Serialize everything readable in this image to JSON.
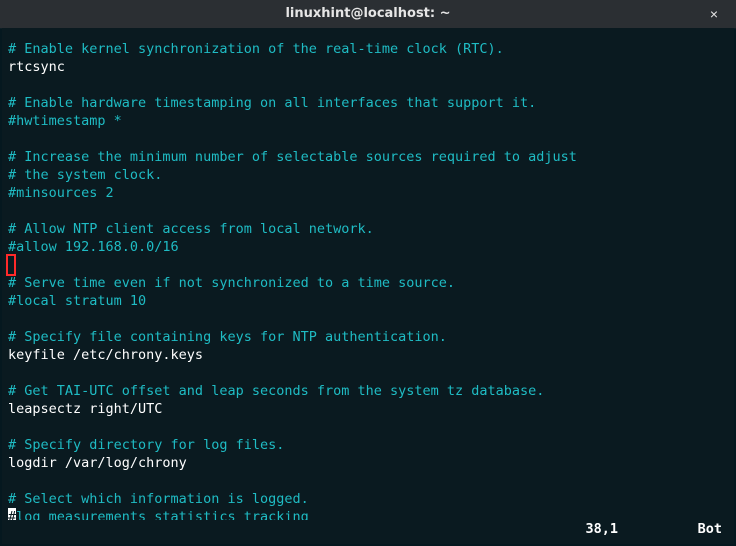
{
  "window": {
    "title": "linuxhint@localhost: ~",
    "close_label": "×"
  },
  "editor": {
    "highlight_line_index": 12,
    "cursor": {
      "line_index": 28,
      "col": 0,
      "char": "#"
    },
    "lines": [
      {
        "type": "cmt",
        "text": "# Enable kernel synchronization of the real-time clock (RTC)."
      },
      {
        "type": "txt",
        "text": "rtcsync"
      },
      {
        "type": "blk",
        "text": ""
      },
      {
        "type": "cmt",
        "text": "# Enable hardware timestamping on all interfaces that support it."
      },
      {
        "type": "cmt",
        "text": "#hwtimestamp *"
      },
      {
        "type": "blk",
        "text": ""
      },
      {
        "type": "cmt",
        "text": "# Increase the minimum number of selectable sources required to adjust"
      },
      {
        "type": "cmt",
        "text": "# the system clock."
      },
      {
        "type": "cmt",
        "text": "#minsources 2"
      },
      {
        "type": "blk",
        "text": ""
      },
      {
        "type": "cmt",
        "text": "# Allow NTP client access from local network."
      },
      {
        "type": "cmt",
        "text": "#allow 192.168.0.0/16"
      },
      {
        "type": "blk",
        "text": ""
      },
      {
        "type": "cmt",
        "text": "# Serve time even if not synchronized to a time source."
      },
      {
        "type": "cmt",
        "text": "#local stratum 10"
      },
      {
        "type": "blk",
        "text": ""
      },
      {
        "type": "cmt",
        "text": "# Specify file containing keys for NTP authentication."
      },
      {
        "type": "txt",
        "text": "keyfile /etc/chrony.keys"
      },
      {
        "type": "blk",
        "text": ""
      },
      {
        "type": "cmt",
        "text": "# Get TAI-UTC offset and leap seconds from the system tz database."
      },
      {
        "type": "txt",
        "text": "leapsectz right/UTC"
      },
      {
        "type": "blk",
        "text": ""
      },
      {
        "type": "cmt",
        "text": "# Specify directory for log files."
      },
      {
        "type": "txt",
        "text": "logdir /var/log/chrony"
      },
      {
        "type": "blk",
        "text": ""
      },
      {
        "type": "cmt",
        "text": "# Select which information is logged."
      },
      {
        "type": "cmt",
        "text": "#log measurements statistics tracking"
      }
    ]
  },
  "status": {
    "position": "38,1",
    "scroll": "Bot"
  }
}
